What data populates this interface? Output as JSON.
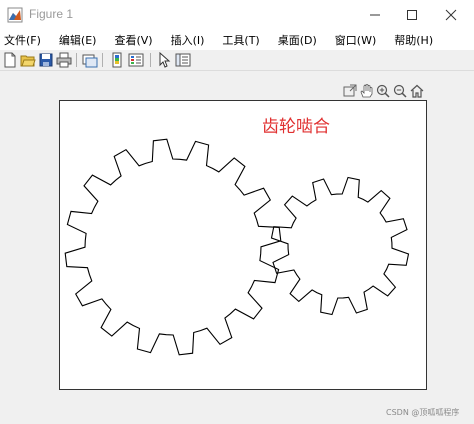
{
  "window": {
    "title": "Figure 1",
    "controls": [
      "minimize",
      "maximize",
      "close"
    ]
  },
  "menu": {
    "items": [
      {
        "label": "文件(F)"
      },
      {
        "label": "编辑(E)"
      },
      {
        "label": "查看(V)"
      },
      {
        "label": "插入(I)"
      },
      {
        "label": "工具(T)"
      },
      {
        "label": "桌面(D)"
      },
      {
        "label": "窗口(W)"
      },
      {
        "label": "帮助(H)"
      }
    ]
  },
  "toolbar": {
    "buttons": [
      "new-figure-icon",
      "open-file-icon",
      "save-icon",
      "print-icon",
      "link-plot-icon",
      "insert-colorbar-icon",
      "insert-legend-icon",
      "edit-plot-arrow-icon",
      "property-inspector-icon"
    ]
  },
  "axes_toolbar": {
    "buttons": [
      "export-icon",
      "pan-hand-icon",
      "zoom-in-icon",
      "zoom-out-icon",
      "home-icon"
    ]
  },
  "plot": {
    "title": "齿轮啮合",
    "title_color": "#e03030"
  },
  "watermark": "CSDN @顶呱呱程序"
}
